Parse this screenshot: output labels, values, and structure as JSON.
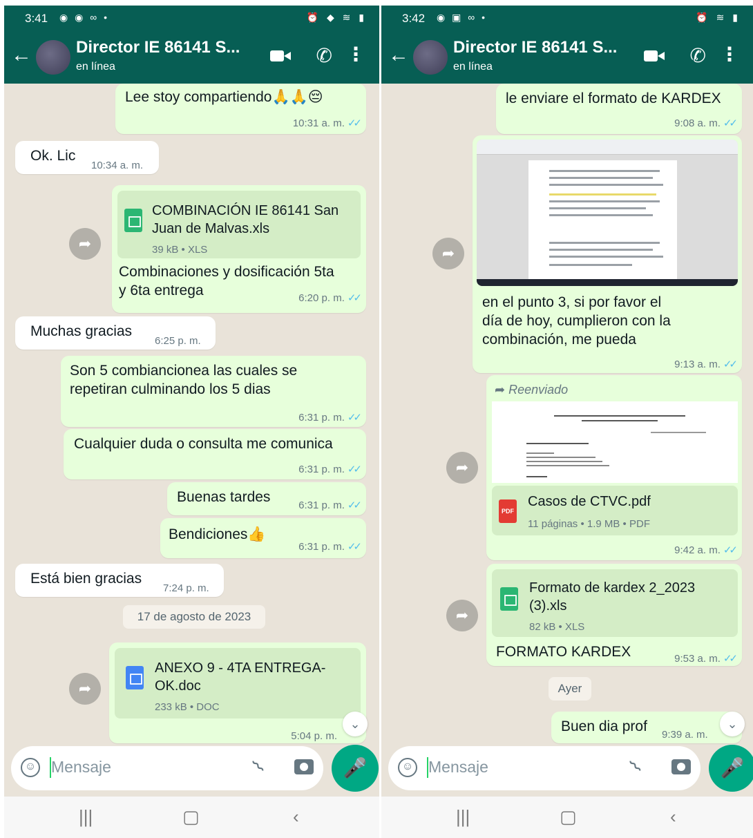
{
  "left": {
    "status": {
      "time": "3:41"
    },
    "header": {
      "title": "Director IE 86141 S...",
      "subtitle": "en línea"
    },
    "messages": {
      "m1": {
        "text": "Lee stoy compartiendo🙏🙏😔",
        "time": "10:31 a. m."
      },
      "m2": {
        "text": "Ok. Lic",
        "time": "10:34 a. m."
      },
      "m3": {
        "file_line1": "COMBINACIÓN IE 86141 San",
        "file_line2": "Juan de Malvas.xls",
        "file_meta": "39 kB • XLS",
        "caption_line1": "Combinaciones y dosificación 5ta",
        "caption_line2": "y  6ta entrega",
        "time": "6:20 p. m."
      },
      "m4": {
        "text": "Muchas gracias",
        "time": "6:25 p. m."
      },
      "m5": {
        "line1": "Son 5 combiancionea las cuales se",
        "line2": "repetiran culminando los 5 dias",
        "time": "6:31 p. m."
      },
      "m6": {
        "text": "Cualquier duda o consulta me comunica",
        "time": "6:31 p. m."
      },
      "m7": {
        "text": "Buenas tardes",
        "time": "6:31 p. m."
      },
      "m8": {
        "text": "Bendiciones👍",
        "time": "6:31 p. m."
      },
      "m9": {
        "text": "Está bien gracias",
        "time": "7:24 p. m."
      },
      "date_chip": "17 de agosto de 2023",
      "m10": {
        "file_line1": "ANEXO 9 - 4TA ENTREGA-",
        "file_line2": "OK.doc",
        "file_meta": "233 kB • DOC",
        "time": "5:04 p. m."
      }
    },
    "input": {
      "placeholder": "Mensaje"
    }
  },
  "right": {
    "status": {
      "time": "3:42"
    },
    "header": {
      "title": "Director IE 86141 S...",
      "subtitle": "en línea"
    },
    "messages": {
      "m1": {
        "text": "le enviare el formato de KARDEX",
        "time": "9:08 a. m."
      },
      "m2": {
        "line1": "en el punto 3, si por favor el",
        "line2": "día de hoy, cumplieron con la",
        "line3": "combinación, me pueda",
        "time": "9:13 a. m."
      },
      "m3": {
        "forwarded": "Reenviado",
        "file_name": "Casos de CTVC.pdf",
        "file_meta": "11 páginas • 1.9 MB • PDF",
        "pdf_badge": "PDF",
        "time": "9:42 a. m."
      },
      "m4": {
        "file_line1": "Formato de kardex 2_2023",
        "file_line2": "(3).xls",
        "file_meta": "82 kB • XLS",
        "caption": "FORMATO KARDEX",
        "time": "9:53 a. m."
      },
      "date_chip": "Ayer",
      "m5": {
        "text": "Buen dia prof",
        "time": "9:39 a. m."
      }
    },
    "input": {
      "placeholder": "Mensaje"
    }
  },
  "colors": {
    "header": "#075e54",
    "outgoing": "#e7ffdb",
    "incoming": "#ffffff",
    "tick": "#53bdeb",
    "mic": "#00a884"
  }
}
